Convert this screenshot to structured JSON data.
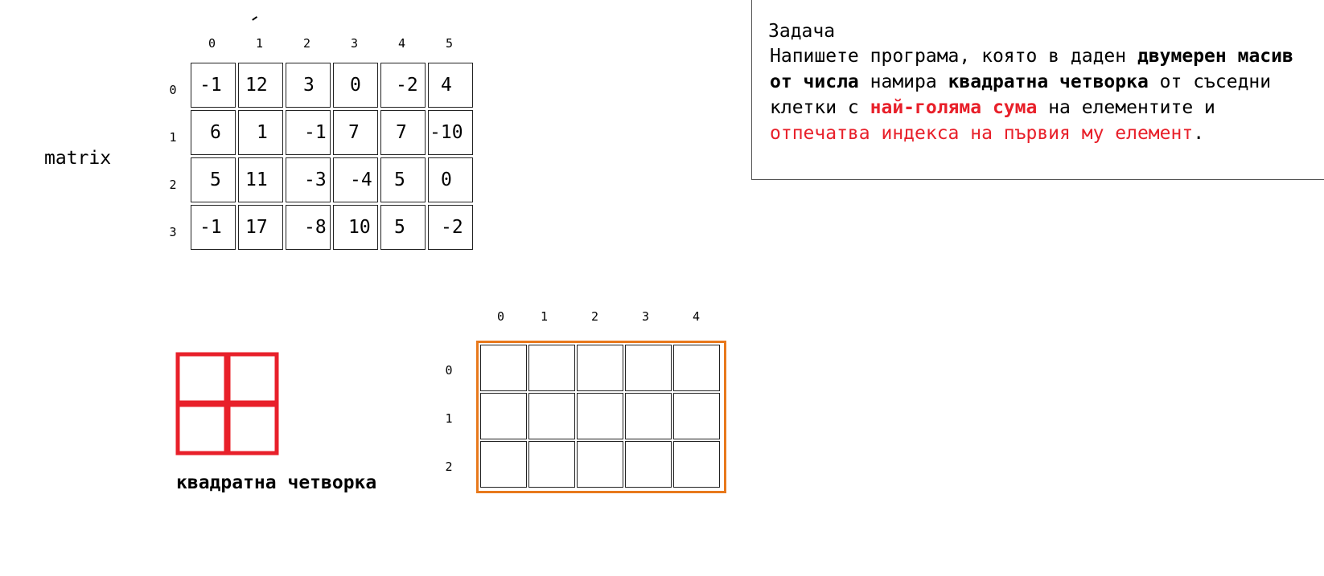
{
  "matrix": {
    "label": "matrix",
    "col_indices": [
      "0",
      "1",
      "2",
      "3",
      "4",
      "5"
    ],
    "row_indices": [
      "0",
      "1",
      "2",
      "3"
    ],
    "rows": [
      [
        "-1",
        "12",
        "3",
        "0",
        "-2",
        "4"
      ],
      [
        "6",
        "1",
        "-1",
        "7",
        "7",
        "-10"
      ],
      [
        "5",
        "11",
        "-3",
        "-4",
        "5",
        "0"
      ],
      [
        "-1",
        "17",
        "-8",
        "10",
        "5",
        "-2"
      ]
    ]
  },
  "legend": {
    "caption": "квадратна четворка",
    "color": "#e8202a"
  },
  "result": {
    "col_indices": [
      "0",
      "1",
      "2",
      "3",
      "4"
    ],
    "row_indices": [
      "0",
      "1",
      "2"
    ],
    "border_color": "#e8791c"
  },
  "task": {
    "title": "Задача",
    "p1": "Напишете програма, която в даден ",
    "b1": "двумерен масив от числа",
    "p2": " намира ",
    "b2": "квадратна четворка",
    "p3": " от съседни клетки с ",
    "r1": "най-голяма сума",
    "p4": " на елементите и ",
    "r2": "отпечатва индекса на първия му елемент",
    "p5": "."
  }
}
